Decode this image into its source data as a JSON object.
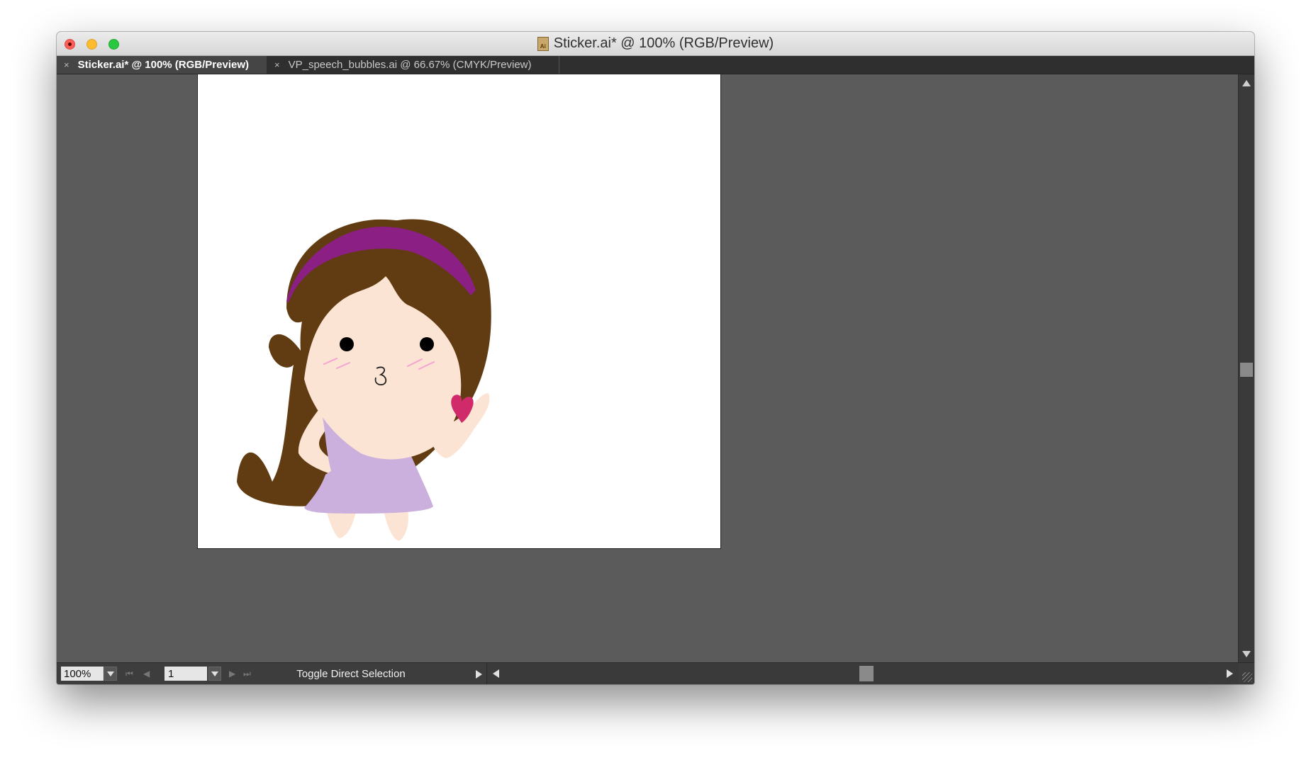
{
  "window": {
    "title": "Sticker.ai* @ 100% (RGB/Preview)",
    "doc_icon_text": "Ai"
  },
  "tabs": [
    {
      "label": "Sticker.ai* @ 100% (RGB/Preview)",
      "active": true
    },
    {
      "label": "VP_speech_bubbles.ai @ 66.67% (CMYK/Preview)",
      "active": false
    }
  ],
  "close_glyph": "×",
  "statusbar": {
    "zoom": "100%",
    "page": "1",
    "status_text": "Toggle Direct Selection"
  },
  "colors": {
    "hair": "#613c12",
    "headband": "#8b1f83",
    "skin": "#fce4d4",
    "dress": "#cbb0de",
    "heart": "#d12a6b",
    "blush": "#f4a3d2",
    "canvas": "#5b5b5b"
  }
}
